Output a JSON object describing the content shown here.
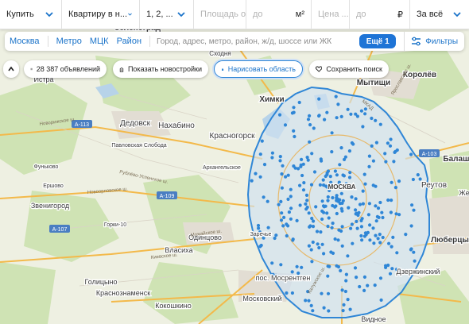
{
  "search": {
    "deal": "Купить",
    "type": "Квартиру в н...",
    "rooms": "1, 2, ...",
    "area_from": "Площадь от",
    "area_to": "до",
    "area_unit": "м²",
    "price_from": "Цена ...",
    "price_to": "до",
    "currency": "₽",
    "period": "За всё"
  },
  "location": {
    "links": [
      "Москва",
      "Метро",
      "МЦК",
      "Район"
    ],
    "placeholder": "Город, адрес, метро, район, ж/д, шоссе или ЖК",
    "more_button": "Ещё 1",
    "filters_button": "Фильтры"
  },
  "toolbar": {
    "count": "28 387 объявлений",
    "new_buildings": "Показать новостройки",
    "draw_area": "Нарисовать область",
    "save_search": "Сохранить поиск"
  },
  "map": {
    "places": [
      "Зеленоград",
      "Сходня",
      "Химки",
      "Королёв",
      "Мытищи",
      "Истра",
      "Дедовск",
      "Нахабино",
      "Красногорск",
      "Павловская Слобода",
      "Фуньково",
      "Архангельское",
      "Ершово",
      "Звенигород",
      "Горки-10",
      "Одинцово",
      "Власиха",
      "Заречье",
      "Балаши",
      "Реутов",
      "Же",
      "Люберцы",
      "Дзержинский",
      "Голицыно",
      "Краснознаменск",
      "Кокошкино",
      "Московский",
      "пос. Мосрентген",
      "Видное",
      "МОСКВА"
    ],
    "roads": [
      "А-113",
      "А-109",
      "А-107",
      "А-103"
    ],
    "road_names": [
      "Новорижское ш.",
      "Рублёво-Успенское ш.",
      "Новоорловское ш.",
      "Киевское ш.",
      "Можайское ш.",
      "Калужское ш.",
      "Ярославское ш.",
      "МКАД"
    ],
    "colors": {
      "area_fill": "#cfe0f0",
      "area_stroke": "#2f86d6",
      "marker": "#2f86d6",
      "road": "#f3b94a"
    }
  }
}
